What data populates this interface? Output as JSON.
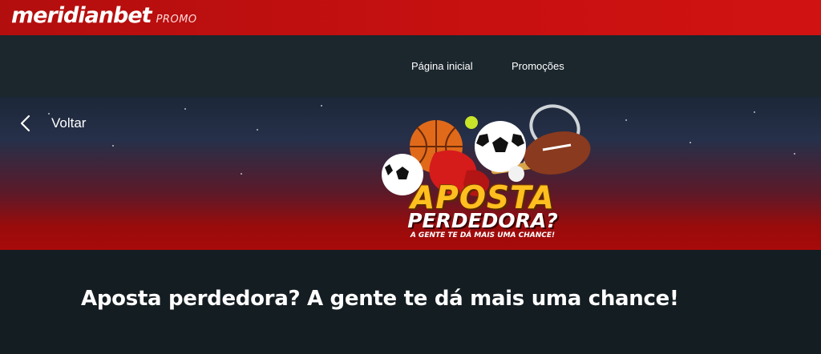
{
  "brand": {
    "name": "meridianbet",
    "tag": "PROMO"
  },
  "nav": {
    "items": [
      {
        "label": "Página inicial"
      },
      {
        "label": "Promoções"
      }
    ]
  },
  "hero": {
    "back_label": "Voltar",
    "promo_title_line1": "APOSTA",
    "promo_title_line2": "PERDEDORA?",
    "promo_subtitle": "A GENTE TE DÁ MAIS UMA CHANCE!"
  },
  "page": {
    "headline": "Aposta perdedora? A gente te dá mais uma chance!"
  },
  "colors": {
    "brand_red": "#c81010",
    "navbar": "#1b262d",
    "page_bg": "#141d22",
    "promo_gold": "#ffbf1f"
  }
}
